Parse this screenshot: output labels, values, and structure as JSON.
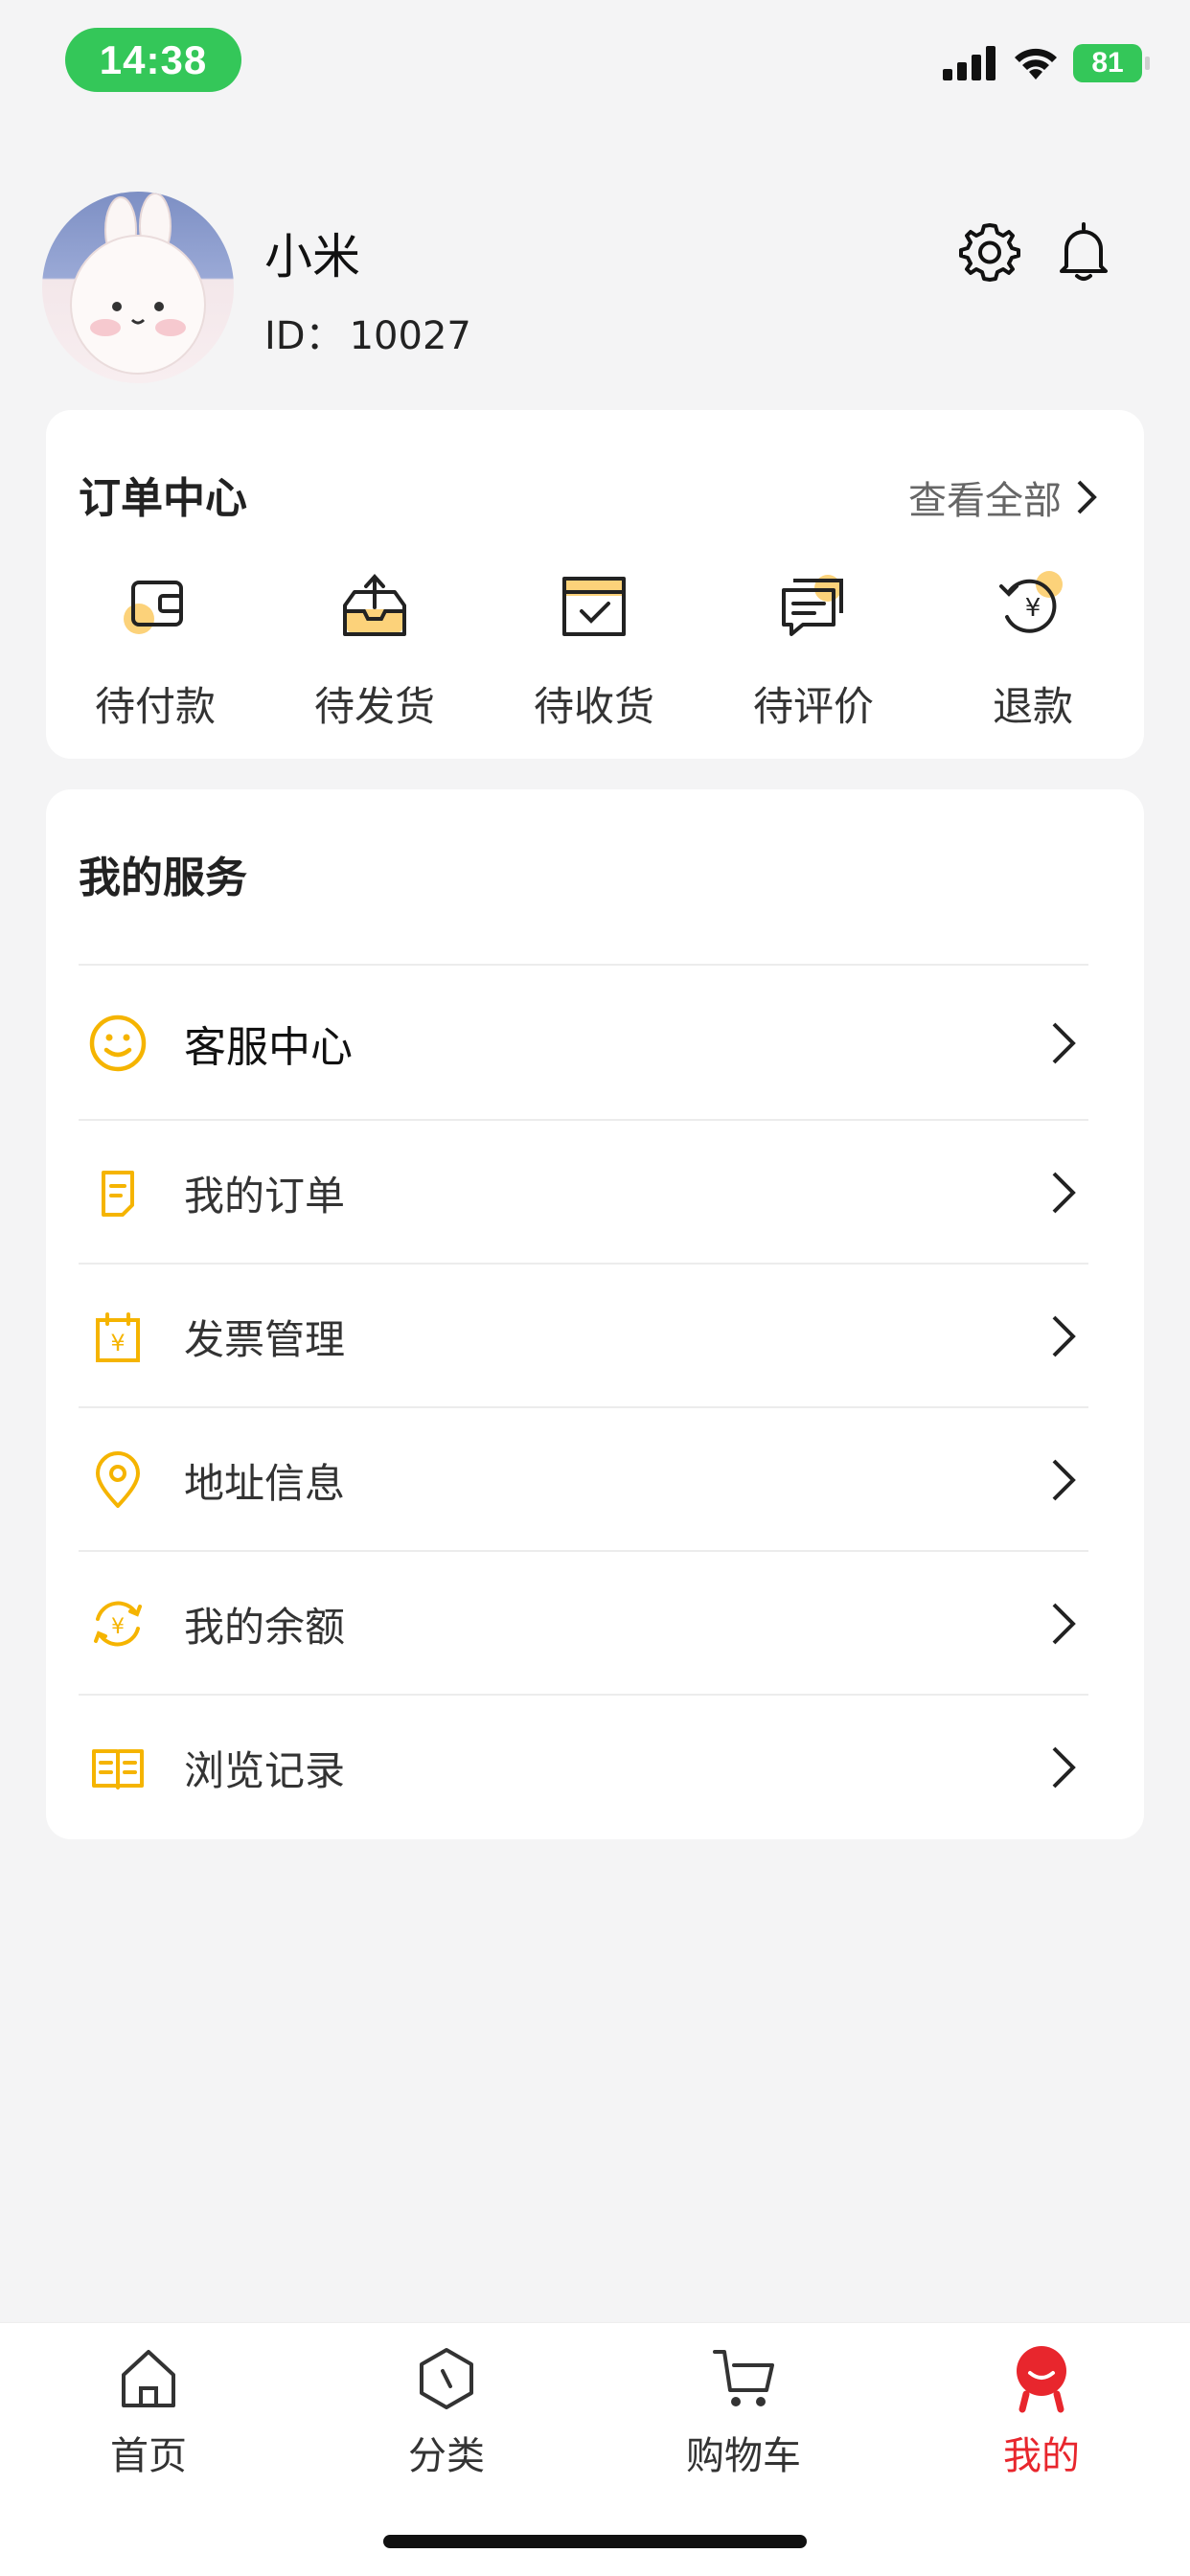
{
  "status_bar": {
    "time": "14:38",
    "battery": "81"
  },
  "profile": {
    "name": "小米",
    "id_label": "ID：",
    "id_value": "10027"
  },
  "colors": {
    "accent": "#f5b400",
    "active_tab": "#e8262d",
    "status_green": "#34c759"
  },
  "order_center": {
    "title": "订单中心",
    "view_all": "查看全部",
    "items": [
      {
        "label": "待付款",
        "icon": "wallet-icon"
      },
      {
        "label": "待发货",
        "icon": "package-icon"
      },
      {
        "label": "待收货",
        "icon": "receive-box-icon"
      },
      {
        "label": "待评价",
        "icon": "review-icon"
      },
      {
        "label": "退款",
        "icon": "refund-icon"
      }
    ]
  },
  "services": {
    "title": "我的服务",
    "items": [
      {
        "label": "客服中心",
        "icon": "smiley-icon"
      },
      {
        "label": "我的订单",
        "icon": "order-doc-icon"
      },
      {
        "label": "发票管理",
        "icon": "invoice-icon"
      },
      {
        "label": "地址信息",
        "icon": "location-icon"
      },
      {
        "label": "我的余额",
        "icon": "balance-icon"
      },
      {
        "label": "浏览记录",
        "icon": "history-book-icon"
      }
    ]
  },
  "tabs": [
    {
      "label": "首页",
      "icon": "home-icon"
    },
    {
      "label": "分类",
      "icon": "category-icon"
    },
    {
      "label": "购物车",
      "icon": "cart-icon"
    },
    {
      "label": "我的",
      "icon": "profile-icon",
      "active": true
    }
  ]
}
